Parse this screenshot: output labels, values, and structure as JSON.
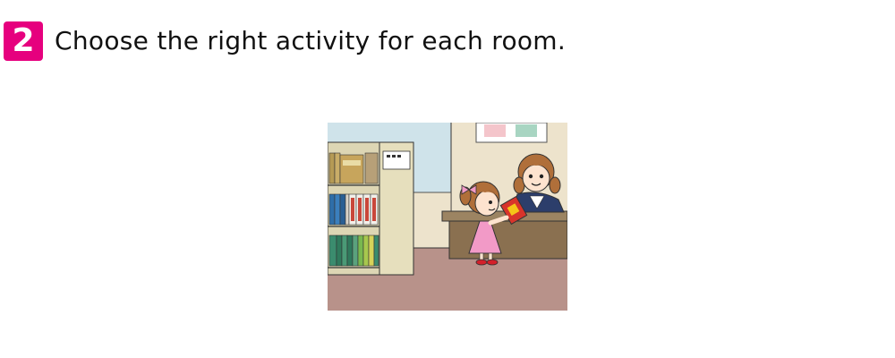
{
  "question": {
    "number": "2",
    "instruction": "Choose the right activity for each room."
  },
  "illustration": {
    "subject": "library-counter",
    "colors": {
      "wall_left": "#cfe3ea",
      "wall_right": "#ede3cc",
      "floor": "#b8928a",
      "shelf": "#ddd6b4",
      "counter": "#8a7050",
      "dress_pink": "#f29ac7",
      "hair_brown": "#b06f3a",
      "librarian_uniform": "#2c3e6b"
    }
  }
}
